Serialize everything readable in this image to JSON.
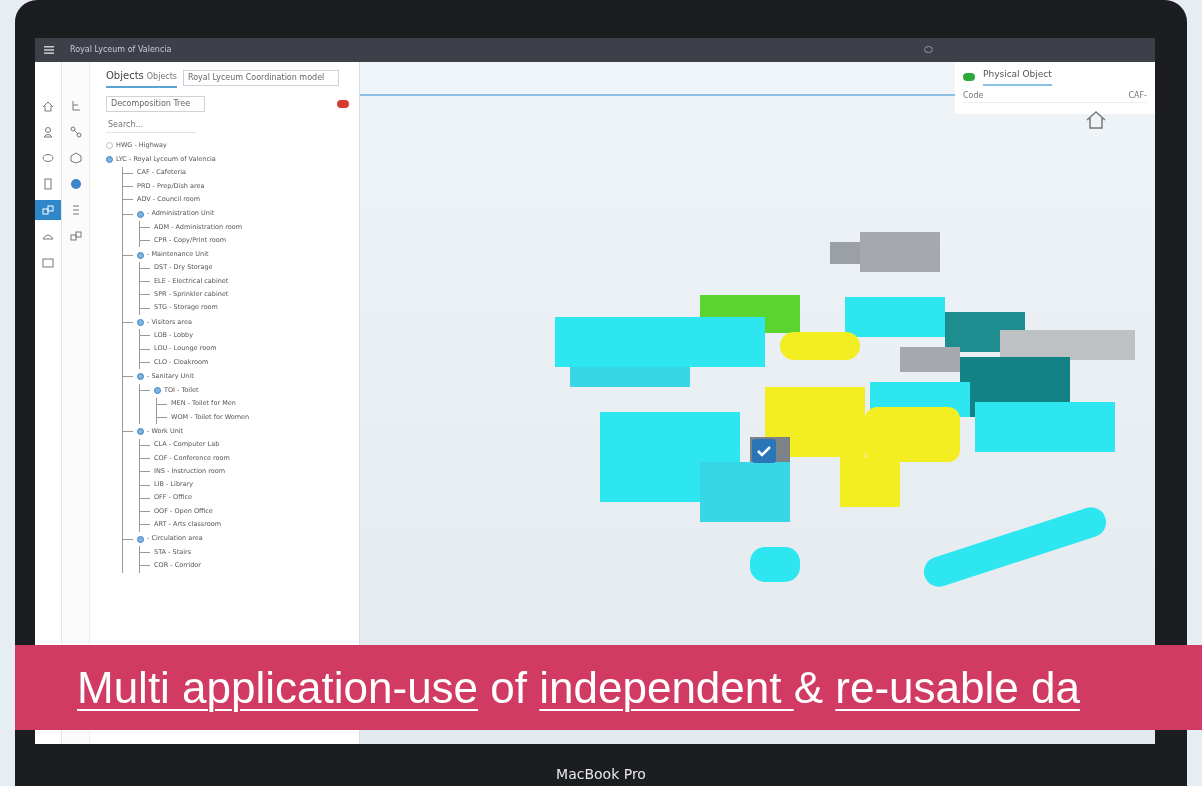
{
  "device_label": "MacBook Pro",
  "window": {
    "title": "Royal Lyceum of Valencia"
  },
  "rail": [
    {
      "selected": false
    },
    {
      "selected": false
    },
    {
      "selected": false
    },
    {
      "selected": false
    },
    {
      "selected": true
    },
    {
      "selected": false
    },
    {
      "selected": false
    }
  ],
  "subrail": [
    {
      "selected": false
    },
    {
      "selected": false
    },
    {
      "selected": false
    },
    {
      "selected": true
    },
    {
      "selected": false
    },
    {
      "selected": false
    }
  ],
  "objects_panel": {
    "title": "Objects",
    "subtitle": "Objects",
    "model_select": "Royal Lyceum Coordination model",
    "view_select": "Decomposition Tree",
    "search": {
      "placeholder": "Search..."
    },
    "toggle": {
      "on": false
    },
    "tree": [
      {
        "label": "HWG - Highway",
        "expanded": false
      },
      {
        "label": "LYC - Royal Lyceum of Valencia",
        "expanded": true,
        "children": [
          {
            "label": "CAF - Cafeteria"
          },
          {
            "label": "PRD - Prep/Dish area"
          },
          {
            "label": "ADV - Council room"
          },
          {
            "label": "- Administration Unit",
            "expanded": true,
            "children": [
              {
                "label": "ADM - Administration room"
              },
              {
                "label": "CPR - Copy/Print room"
              }
            ]
          },
          {
            "label": "- Maintenance Unit",
            "expanded": true,
            "children": [
              {
                "label": "DST - Dry Storage"
              },
              {
                "label": "ELE - Electrical cabinet"
              },
              {
                "label": "SPR - Sprinkler cabinet"
              },
              {
                "label": "STG - Storage room"
              }
            ]
          },
          {
            "label": "- Visitors area",
            "expanded": true,
            "children": [
              {
                "label": "LOB - Lobby"
              },
              {
                "label": "LOU - Lounge room"
              },
              {
                "label": "CLO - Cloakroom"
              }
            ]
          },
          {
            "label": "- Sanitary Unit",
            "expanded": true,
            "children": [
              {
                "label": "TOI - Toilet",
                "expanded": true,
                "children": [
                  {
                    "label": "MEN - Toilet for Men"
                  },
                  {
                    "label": "WOM - Toilet for Women"
                  }
                ]
              }
            ]
          },
          {
            "label": "- Work Unit",
            "expanded": true,
            "children": [
              {
                "label": "CLA - Computer Lab"
              },
              {
                "label": "COF - Conference room"
              },
              {
                "label": "INS - Instruction room"
              },
              {
                "label": "LIB - Library"
              },
              {
                "label": "OFF - Office"
              },
              {
                "label": "OOF - Open Office"
              },
              {
                "label": "ART - Arts classroom"
              }
            ]
          },
          {
            "label": "- Circulation area",
            "expanded": true,
            "children": [
              {
                "label": "STA - Stairs"
              },
              {
                "label": "COR - Corridor"
              }
            ]
          }
        ]
      }
    ]
  },
  "properties_panel": {
    "title": "Physical Object",
    "toggle": {
      "on": true
    },
    "fields": [
      {
        "label": "Code",
        "value": "CAF-"
      }
    ]
  },
  "banner": {
    "segments": [
      {
        "text": "Multi application-use",
        "underlined": true
      },
      {
        "text": " of ",
        "underlined": false
      },
      {
        "text": "independent ",
        "underlined": true
      },
      {
        "text": "& ",
        "underlined": false
      },
      {
        "text": "re-usable da",
        "underlined": true
      }
    ]
  }
}
